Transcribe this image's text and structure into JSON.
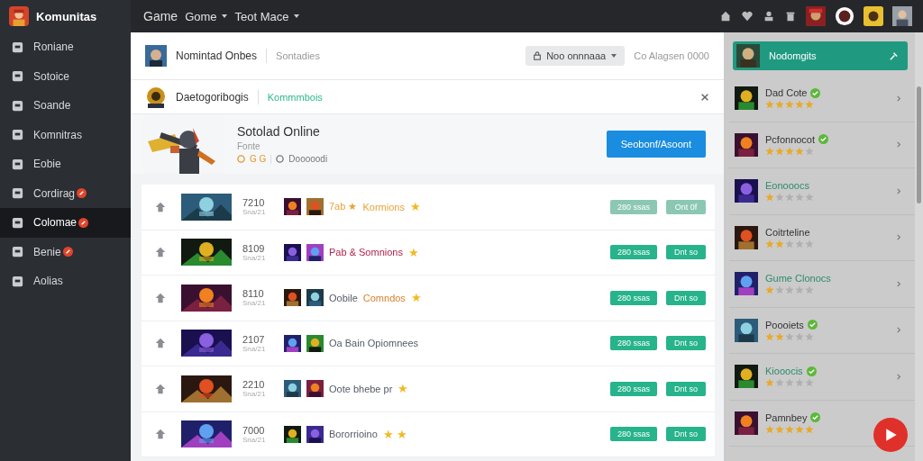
{
  "brand": {
    "name": "Komunitas"
  },
  "topnav": [
    {
      "label": "Game",
      "dropdown": false
    },
    {
      "label": "Gome",
      "dropdown": true
    },
    {
      "label": "Teot Mace",
      "dropdown": true
    }
  ],
  "sidebar": {
    "items": [
      {
        "label": "Roniane",
        "selected": false,
        "badge": false
      },
      {
        "label": "Sotoice",
        "selected": false,
        "badge": false
      },
      {
        "label": "Soande",
        "selected": false,
        "badge": false
      },
      {
        "label": "Komnitras",
        "selected": false,
        "badge": false
      },
      {
        "label": "Eobie",
        "selected": false,
        "badge": false
      },
      {
        "label": "Cordirag",
        "selected": false,
        "badge": true
      },
      {
        "label": "Colomae",
        "selected": true,
        "badge": true
      },
      {
        "label": "Benie",
        "selected": false,
        "badge": true
      },
      {
        "label": "Aolias",
        "selected": false,
        "badge": false
      }
    ]
  },
  "header": {
    "title": "Nomintad Onbes",
    "subtitle": "Sontadies",
    "dropdown": "Noo onnnaaa",
    "meta": "Co Alagsen 0000"
  },
  "notice": {
    "title": "Daetogoribogis",
    "link": "Kommmbois"
  },
  "game": {
    "title": "Sotolad Online",
    "genre": "Fonte",
    "rating": "G G",
    "players": "Dooooodi",
    "button": "Seobonf/Asoont"
  },
  "rows": [
    {
      "number": "7210",
      "sub": "Sna/21",
      "lead": "7ab ★",
      "title": "Kormions",
      "color": "#e8a33a",
      "suffix": "★",
      "buttons": [
        "280 ssas",
        "Ont 0f"
      ],
      "disabled": true
    },
    {
      "number": "8109",
      "sub": "Sna/21",
      "lead": "",
      "title": "Pab & Somnions",
      "color": "#b0234a",
      "suffix": "★",
      "buttons": [
        "280 ssas",
        "Dnt so"
      ],
      "disabled": false
    },
    {
      "number": "8110",
      "sub": "Sna/21",
      "lead": "Oobile",
      "title": "Comndos",
      "color": "#d9822b",
      "suffix": "★",
      "buttons": [
        "280 ssas",
        "Dnt so"
      ],
      "disabled": false
    },
    {
      "number": "2107",
      "sub": "Sna/21",
      "lead": "",
      "title": "Oa Bain Opiomnees",
      "color": "#555b66",
      "buttons": [
        "280 ssas",
        "Dnt so"
      ],
      "disabled": false
    },
    {
      "number": "2210",
      "sub": "Sna/21",
      "lead": "",
      "title": "Oote bhebe pr",
      "color": "#555b66",
      "suffix": "★",
      "buttons": [
        "280 ssas",
        "Dnt so"
      ],
      "disabled": false
    },
    {
      "number": "7000",
      "sub": "Sna/21",
      "lead": "",
      "title": "Bororrioino",
      "color": "#555b66",
      "suffix": "★ ★",
      "buttons": [
        "280 ssas",
        "Dnt so"
      ],
      "disabled": false
    }
  ],
  "panel": {
    "title": "Nodomgits",
    "items": [
      {
        "name": "Dad Cote",
        "verified": true,
        "stars": 5,
        "color": "#333333"
      },
      {
        "name": "Pcfonnocot",
        "verified": true,
        "stars": 4,
        "color": "#333333"
      },
      {
        "name": "Eonooocs",
        "verified": false,
        "stars": 1,
        "color": "#2e8b6a"
      },
      {
        "name": "Coitrteline",
        "verified": false,
        "stars": 2,
        "color": "#333333"
      },
      {
        "name": "Gume Clonocs",
        "verified": false,
        "stars": 1,
        "color": "#2e8b6a"
      },
      {
        "name": "Poooiets",
        "verified": true,
        "stars": 2,
        "color": "#333333"
      },
      {
        "name": "Kiooocis",
        "verified": true,
        "stars": 1,
        "color": "#2e8b6a"
      },
      {
        "name": "Pamnbey",
        "verified": true,
        "stars": 5,
        "color": "#333333"
      }
    ]
  }
}
